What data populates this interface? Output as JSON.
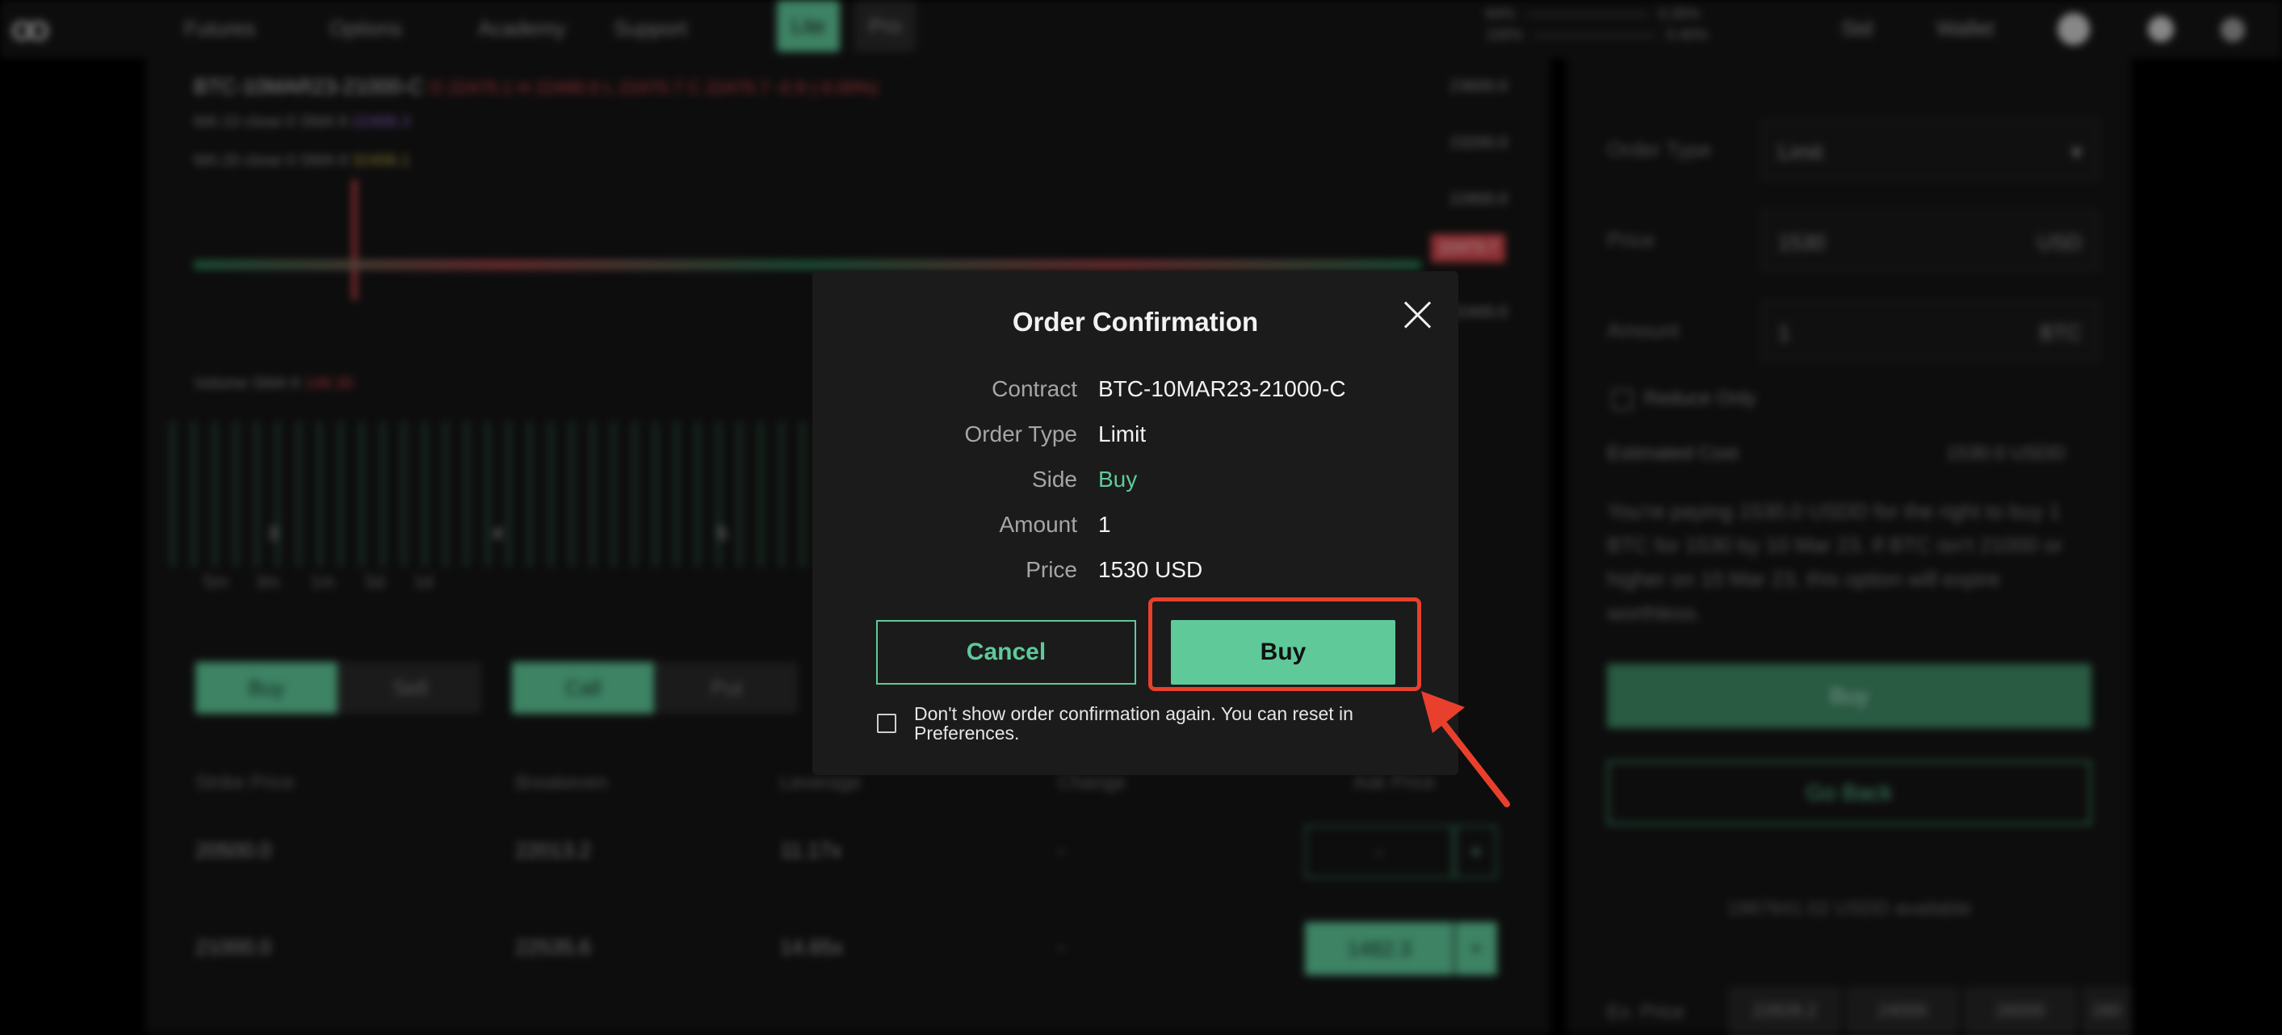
{
  "nav": {
    "logo": "OO",
    "items": [
      "Futures",
      "Options",
      "Academy",
      "Support"
    ],
    "mode_lite": "Lite",
    "mode_pro": "Pro",
    "stats": [
      {
        "label": "84%",
        "value": "0.35%"
      },
      {
        "label": "100%",
        "value": "0.40%"
      }
    ],
    "std": "Std",
    "wallet": "Wallet"
  },
  "chart": {
    "contract_title": "BTC-10MAR23-21000-C",
    "ohlc": "O 22470.1  H 22490.0  L 22470.7  C 22470.7  -0.9 (-0.00%)",
    "ma1_label": "MA 10 close 0 SMA 9",
    "ma1_value": "22406.3",
    "ma2_label": "MA 20 close 0 SMA 9",
    "ma2_value": "32406.1",
    "price_axis": [
      "23600.0",
      "23200.0",
      "22800.0",
      "22400.0"
    ],
    "price_tag": "22473.7",
    "volume_label": "Volume SMA 9",
    "volume_value": "148.30",
    "x_ticks": [
      "3",
      "4",
      "5"
    ],
    "timeframes": [
      "5m",
      "3m",
      "1m",
      "5d",
      "1d"
    ]
  },
  "order_panel": {
    "buy": "Buy",
    "sell": "Sell",
    "call": "Call",
    "put": "Put",
    "headers": [
      "Strike Price",
      "Breakeven",
      "Leverage",
      "Change",
      "Ask Price"
    ],
    "rows": [
      {
        "strike": "20500.0",
        "breakeven": "22013.2",
        "leverage": "11.17x",
        "change": "-",
        "ask": "-"
      },
      {
        "strike": "21000.0",
        "breakeven": "22535.6",
        "leverage": "14.65x",
        "change": "-",
        "ask": "1482.3"
      }
    ]
  },
  "side_panel": {
    "order_type_label": "Order Type",
    "order_type_value": "Limit",
    "price_label": "Price",
    "price_value": "1530",
    "price_unit": "USD",
    "amount_label": "Amount",
    "amount_value": "1",
    "amount_unit": "BTC",
    "reduce_only": "Reduce Only",
    "est_cost_label": "Estimated Cost",
    "est_cost_value": "1530.0 USDD",
    "description": "You're paying 1530.0 USDD for the right to buy 1 BTC for 1530 by 10 Mar 23. If BTC isn't 21000 or higher on 10 Mar 23, this option will expire worthless.",
    "buy_button": "Buy",
    "go_back": "Go Back",
    "available": "1987641.02 USDD available",
    "exp_label": "Ex. Price",
    "chips": [
      "22828.2",
      "24000",
      "26000",
      "280"
    ]
  },
  "modal": {
    "title": "Order Confirmation",
    "details": [
      {
        "key": "Contract",
        "value": "BTC-10MAR23-21000-C"
      },
      {
        "key": "Order Type",
        "value": "Limit"
      },
      {
        "key": "Side",
        "value": "Buy"
      },
      {
        "key": "Amount",
        "value": "1"
      },
      {
        "key": "Price",
        "value": "1530 USD"
      }
    ],
    "cancel_label": "Cancel",
    "buy_label": "Buy",
    "confirm_text": "Don't show order confirmation again. You can reset in Preferences."
  },
  "colors": {
    "accent_green": "#5fc99a",
    "highlight_red": "#e8402c",
    "modal_bg": "#1b1b1b"
  }
}
